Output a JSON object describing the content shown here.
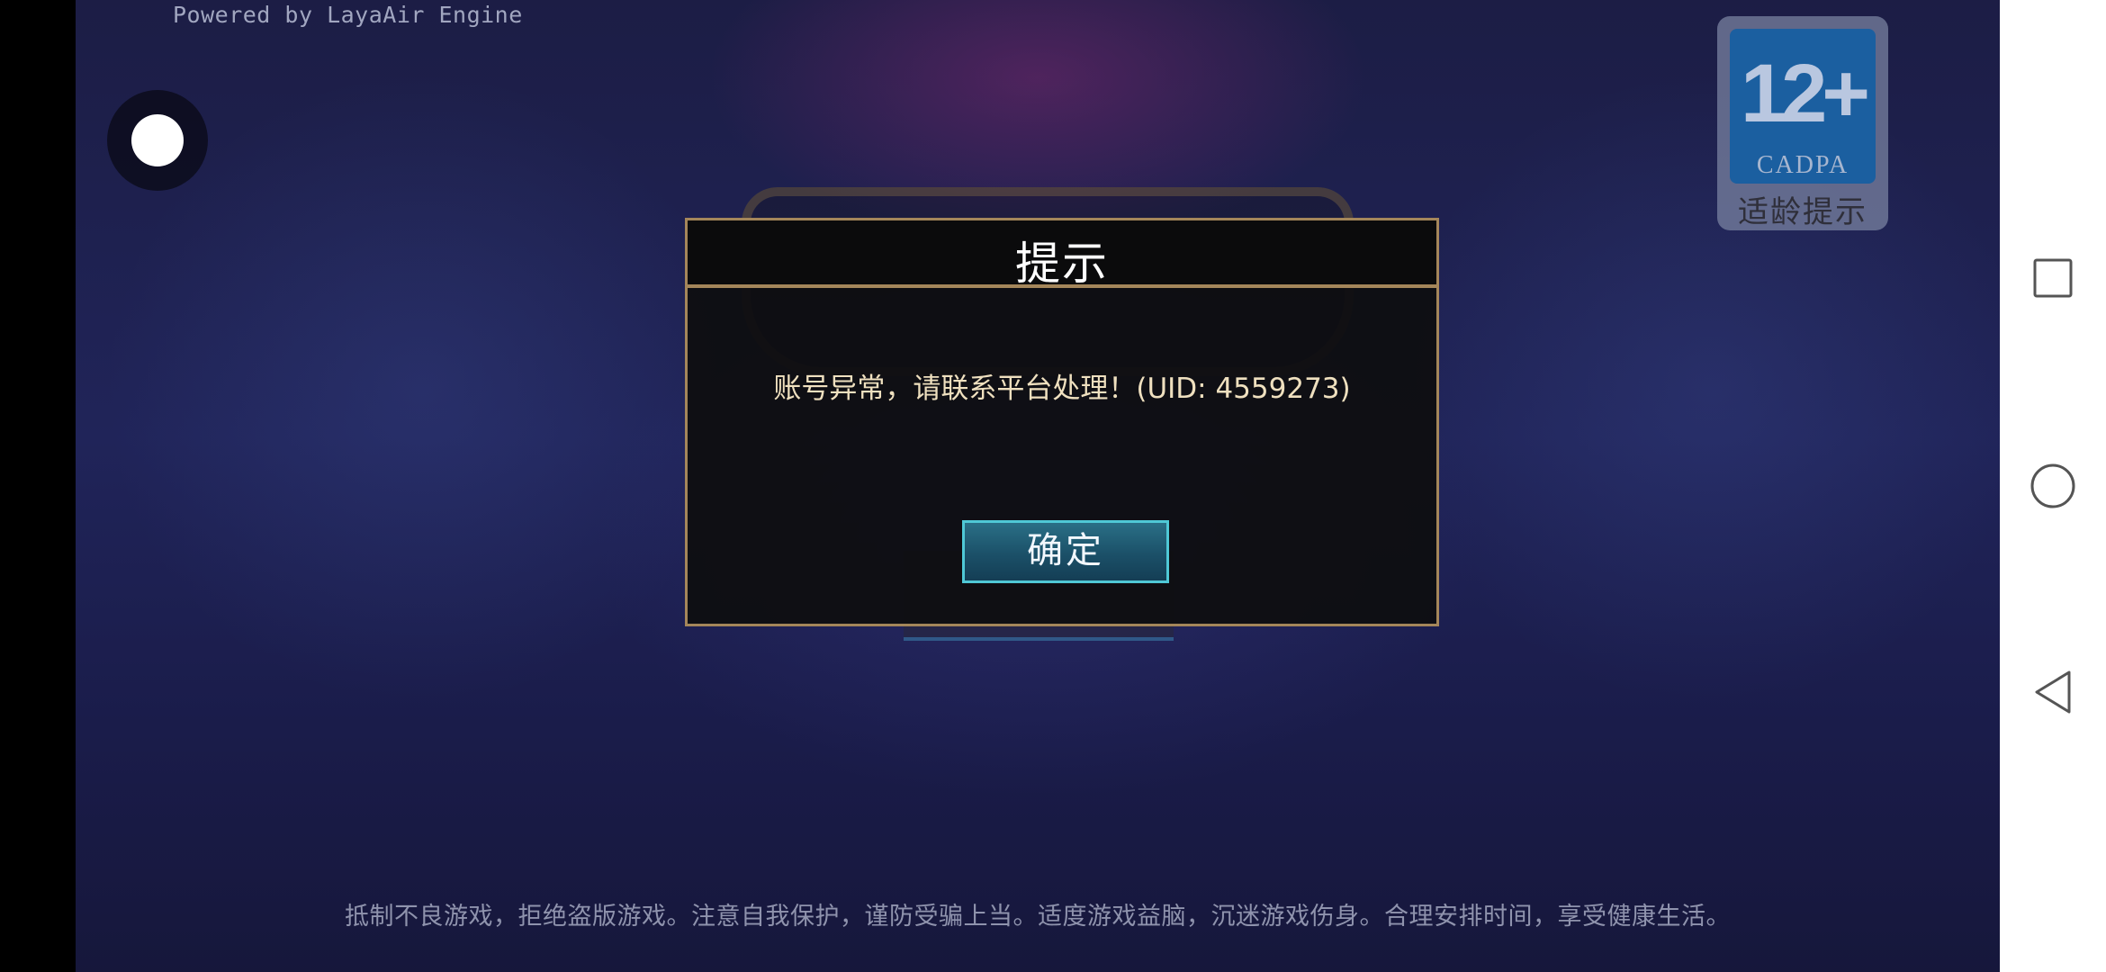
{
  "game": {
    "powered_by": "Powered by LayaAir Engine",
    "age_rating": {
      "number": "12+",
      "org": "CADPA",
      "label": "适龄提示"
    }
  },
  "dialog": {
    "title": "提示",
    "message": "账号异常，请联系平台处理！(UID: 4559273)",
    "confirm_label": "确定"
  },
  "footer": {
    "notice": "抵制不良游戏，拒绝盗版游戏。注意自我保护，谨防受骗上当。适度游戏益脑，沉迷游戏伤身。合理安排时间，享受健康生活。"
  },
  "navbar": {
    "icons": [
      "recent-apps-icon",
      "home-icon",
      "back-icon"
    ]
  },
  "colors": {
    "dialog_border": "#a4865a",
    "button_border": "#4fc8d6",
    "background": "#1c1d45"
  }
}
